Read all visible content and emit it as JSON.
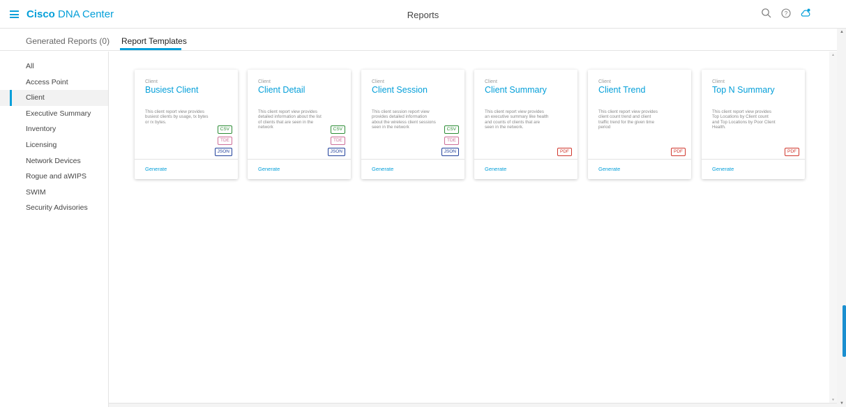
{
  "header": {
    "brand_bold": "Cisco",
    "brand_rest": "DNA Center",
    "title": "Reports",
    "icons": [
      "menu-icon",
      "search-icon",
      "help-icon",
      "notification-cloud-icon"
    ],
    "accent_color": "#049fd9"
  },
  "tabs": [
    {
      "label": "Generated Reports (0)",
      "active": false
    },
    {
      "label": "Report Templates",
      "active": true
    }
  ],
  "sidebar": {
    "items": [
      {
        "label": "All"
      },
      {
        "label": "Access Point"
      },
      {
        "label": "Client",
        "active": true
      },
      {
        "label": "Executive Summary"
      },
      {
        "label": "Inventory"
      },
      {
        "label": "Licensing"
      },
      {
        "label": "Network Devices"
      },
      {
        "label": "Rogue and aWIPS"
      },
      {
        "label": "SWIM"
      },
      {
        "label": "Security Advisories"
      }
    ]
  },
  "cards": [
    {
      "category": "Client",
      "title": "Busiest Client",
      "description": "This client report view provides busiest clients by usage, tx bytes or rx bytes.",
      "formats": [
        "CSV",
        "TDE",
        "JSON"
      ],
      "action": "Generate"
    },
    {
      "category": "Client",
      "title": "Client Detail",
      "description": "This client report view provides detailed information about the list of clients that are seen in the network",
      "formats": [
        "CSV",
        "TDE",
        "JSON"
      ],
      "action": "Generate"
    },
    {
      "category": "Client",
      "title": "Client Session",
      "description": "This client session report view provides detailed information about the wireless client sessions seen in the network",
      "formats": [
        "CSV",
        "TDE",
        "JSON"
      ],
      "action": "Generate"
    },
    {
      "category": "Client",
      "title": "Client Summary",
      "description": "This client report view provides an executive summary like health and counts of clients that are seen in the network.",
      "formats": [
        "PDF"
      ],
      "action": "Generate"
    },
    {
      "category": "Client",
      "title": "Client Trend",
      "description": "This client report view provides client count trend and client traffic trend for the given time period",
      "formats": [
        "PDF"
      ],
      "action": "Generate"
    },
    {
      "category": "Client",
      "title": "Top N Summary",
      "description": "This client report view provides Top Locations by Client count and Top Locations by Poor Client Health.",
      "formats": [
        "PDF"
      ],
      "action": "Generate"
    }
  ]
}
